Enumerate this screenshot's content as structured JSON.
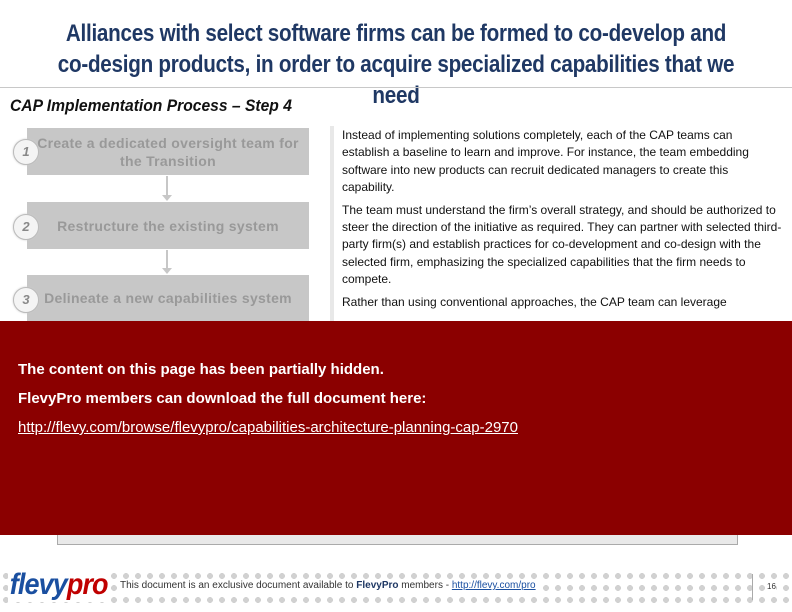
{
  "header": {
    "title": "Alliances with select software firms can be formed to co-develop and co-design products, in order to acquire specialized capabilities that we need",
    "subtitle": "CAP Implementation Process – Step 4"
  },
  "steps": [
    {
      "number": "1",
      "label": "Create a dedicated oversight team for the Transition"
    },
    {
      "number": "2",
      "label": "Restructure the existing system"
    },
    {
      "number": "3",
      "label": "Delineate a new capabilities system"
    }
  ],
  "body": {
    "paragraphs": [
      "Instead of implementing solutions completely, each of the CAP teams can establish a baseline to learn and improve.  For instance, the team embedding software into new products can recruit dedicated managers to create this capability.",
      "The team must understand the firm’s overall strategy, and should be authorized to steer the direction of the initiative as required.  They can partner with selected third-party firm(s) and establish practices for co-development and co-design with the selected firm, emphasizing the specialized capabilities that the firm needs to compete.",
      "Rather than using conventional approaches, the CAP team can leverage"
    ]
  },
  "overlay": {
    "line1": "The content on this page has been partially hidden.",
    "line2": "FlevyPro members can download the full document here:",
    "link": "http://flevy.com/browse/flevypro/capabilities-architecture-planning-cap-2970",
    "color": "#8b0000"
  },
  "footer": {
    "logo_part1": "flevy",
    "logo_part2": "pro",
    "text_prefix": "This document is an exclusive document available to ",
    "text_brand": "FlevyPro",
    "text_mid": " members - ",
    "link": "http://flevy.com/pro",
    "page_number": "16"
  }
}
